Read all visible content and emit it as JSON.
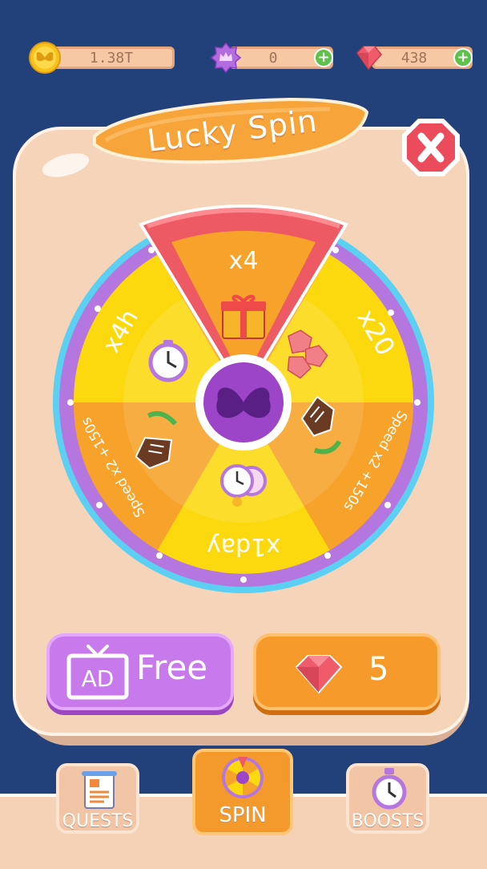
{
  "topbar": {
    "coins": {
      "value": "1.38T",
      "icon": "butterfly-coin-icon"
    },
    "crowns": {
      "value": "0",
      "icon": "purple-crown-badge-icon"
    },
    "gems": {
      "value": "438",
      "icon": "ruby-gem-icon"
    }
  },
  "dialog": {
    "title": "Lucky Spin",
    "close_icon": "close-x-icon"
  },
  "wheel": {
    "center_icon": "purple-butterfly-icon",
    "segments": [
      {
        "label": "x4",
        "icon": "gift-box-icon",
        "color": "#f7a22a"
      },
      {
        "label": "x20",
        "icon": "gems-icon",
        "color": "#fcd90f"
      },
      {
        "label": "Speed x2 +150s",
        "icon": "boot-speed-icon",
        "color": "#f7a22a"
      },
      {
        "label": "x1day",
        "icon": "double-clock-icon",
        "color": "#fcd90f"
      },
      {
        "label": "Speed x2 +150s",
        "icon": "boot-speed-icon",
        "color": "#f7a22a"
      },
      {
        "label": "x4h",
        "icon": "stopwatch-icon",
        "color": "#fcd90f"
      }
    ],
    "pointer_color": "#ee5a63",
    "ring_color": "#b676e0"
  },
  "buttons": {
    "ad": {
      "badge": "AD",
      "label": "Free"
    },
    "gem": {
      "cost": "5"
    }
  },
  "nav": {
    "quests": "QUESTS",
    "spin": "SPIN",
    "boosts": "BOOSTS"
  }
}
